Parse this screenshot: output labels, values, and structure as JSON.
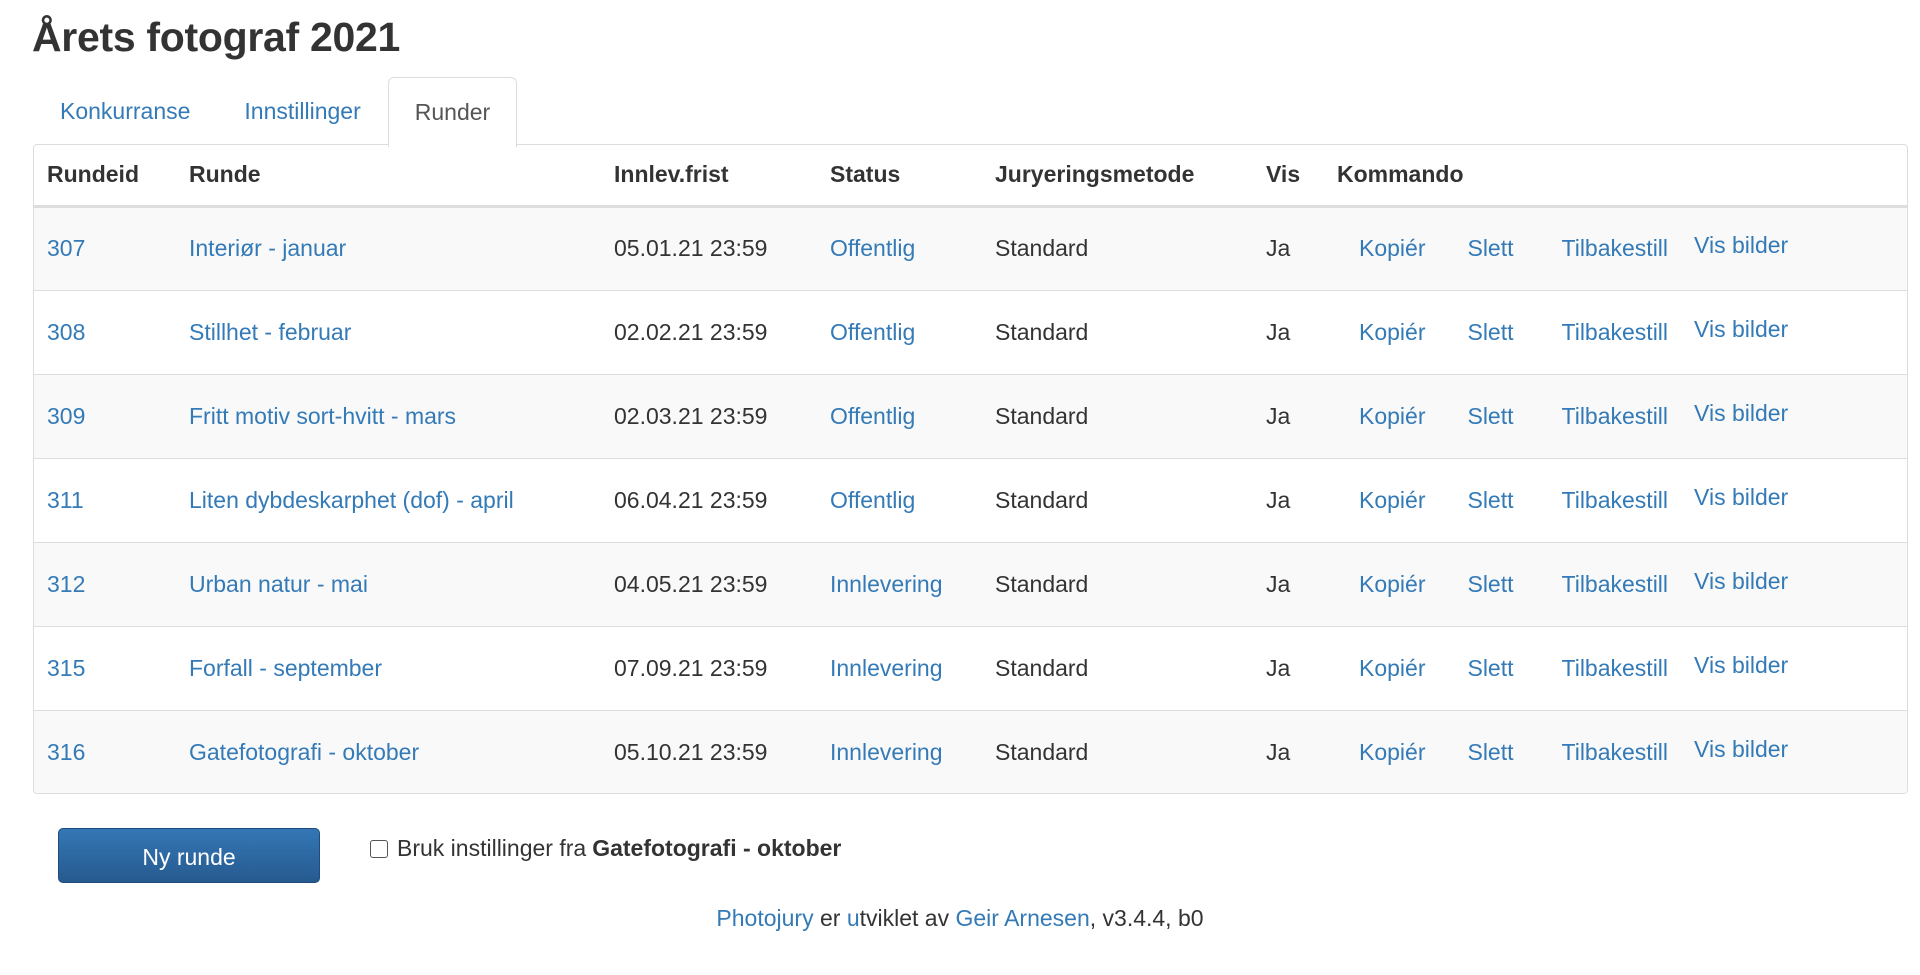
{
  "page_title": "Årets fotograf 2021",
  "tabs": [
    {
      "label": "Konkurranse",
      "active": false
    },
    {
      "label": "Innstillinger",
      "active": false
    },
    {
      "label": "Runder",
      "active": true
    }
  ],
  "table": {
    "headers": {
      "id": "Rundeid",
      "name": "Runde",
      "deadline": "Innlev.frist",
      "status": "Status",
      "method": "Juryeringsmetode",
      "show": "Vis",
      "command": "Kommando"
    },
    "commands": {
      "copy": "Kopiér",
      "delete": "Slett",
      "reset": "Tilbakestill",
      "show_images": "Vis bilder"
    },
    "rows": [
      {
        "id": "307",
        "name": "Interiør - januar",
        "deadline": "05.01.21 23:59",
        "status": "Offentlig",
        "method": "Standard",
        "show": "Ja"
      },
      {
        "id": "308",
        "name": "Stillhet - februar",
        "deadline": "02.02.21 23:59",
        "status": "Offentlig",
        "method": "Standard",
        "show": "Ja"
      },
      {
        "id": "309",
        "name": "Fritt motiv sort-hvitt - mars",
        "deadline": "02.03.21 23:59",
        "status": "Offentlig",
        "method": "Standard",
        "show": "Ja"
      },
      {
        "id": "311",
        "name": "Liten dybdeskarphet (dof) - april",
        "deadline": "06.04.21 23:59",
        "status": "Offentlig",
        "method": "Standard",
        "show": "Ja"
      },
      {
        "id": "312",
        "name": "Urban natur - mai",
        "deadline": "04.05.21 23:59",
        "status": "Innlevering",
        "method": "Standard",
        "show": "Ja"
      },
      {
        "id": "315",
        "name": "Forfall - september",
        "deadline": "07.09.21 23:59",
        "status": "Innlevering",
        "method": "Standard",
        "show": "Ja"
      },
      {
        "id": "316",
        "name": "Gatefotografi - oktober",
        "deadline": "05.10.21 23:59",
        "status": "Innlevering",
        "method": "Standard",
        "show": "Ja"
      }
    ]
  },
  "actions": {
    "new_round_label": "Ny runde",
    "checkbox_prefix": "Bruk instillinger fra",
    "checkbox_round": "Gatefotografi - oktober",
    "checkbox_checked": false
  },
  "footer": {
    "app_link": "Photojury",
    "text_er": "er",
    "text_u": "u",
    "text_rest": "tviklet av",
    "author_link": "Geir Arnesen",
    "version": ", v3.4.4, b0"
  },
  "colors": {
    "link": "#337ab7",
    "text": "#333333",
    "button": "#2f6da8",
    "border": "#dddddd",
    "stripe": "#f9f9f9"
  }
}
